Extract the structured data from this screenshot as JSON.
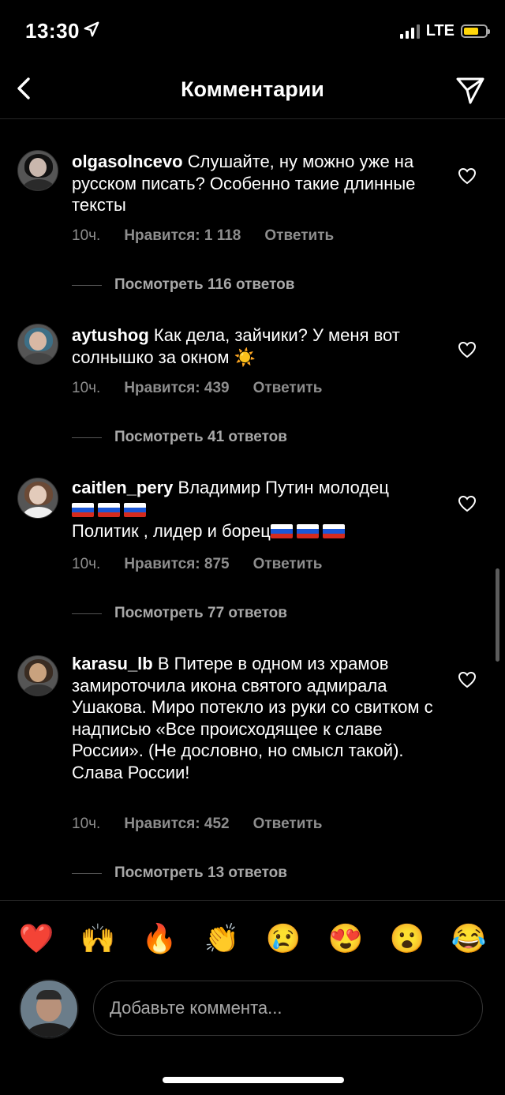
{
  "status_bar": {
    "time": "13:30",
    "network": "LTE",
    "battery_fraction": 0.7
  },
  "header": {
    "title": "Комментарии"
  },
  "comments": [
    {
      "username": "olgasolncevo",
      "text": "Слушайте, ну можно уже на русском писать? Особенно такие длинные тексты",
      "time": "10ч.",
      "likes": "Нравится: 1 118",
      "reply": "Ответить",
      "view_replies": "Посмотреть 116 ответов"
    },
    {
      "username": "aytushog",
      "text": "Как дела, зайчики? У меня вот солнышко за окном",
      "emoji": "☀️",
      "time": "10ч.",
      "likes": "Нравится: 439",
      "reply": "Ответить",
      "view_replies": "Посмотреть 41 ответов"
    },
    {
      "username": "caitlen_pery",
      "text": "Владимир Путин молодец",
      "text2": "Политик , лидер и борец",
      "time": "10ч.",
      "likes": "Нравится: 875",
      "reply": "Ответить",
      "view_replies": "Посмотреть 77 ответов"
    },
    {
      "username": "karasu_lb",
      "text": "В Питере в одном из храмов замироточила икона святого адмирала Ушакова. Миро потекло из руки со свитком с надписью «Все происходящее к славе России». (Не дословно, но смысл такой). Слава России!",
      "time": "10ч.",
      "likes": "Нравится: 452",
      "reply": "Ответить",
      "view_replies": "Посмотреть 13 ответов"
    }
  ],
  "reactions": [
    "❤️",
    "🙌",
    "🔥",
    "👏",
    "😢",
    "😍",
    "😮",
    "😂"
  ],
  "input": {
    "placeholder": "Добавьте коммента..."
  },
  "colors": {
    "background": "#000000",
    "muted_text": "#8e8e8e",
    "battery": "#ffd60a"
  }
}
